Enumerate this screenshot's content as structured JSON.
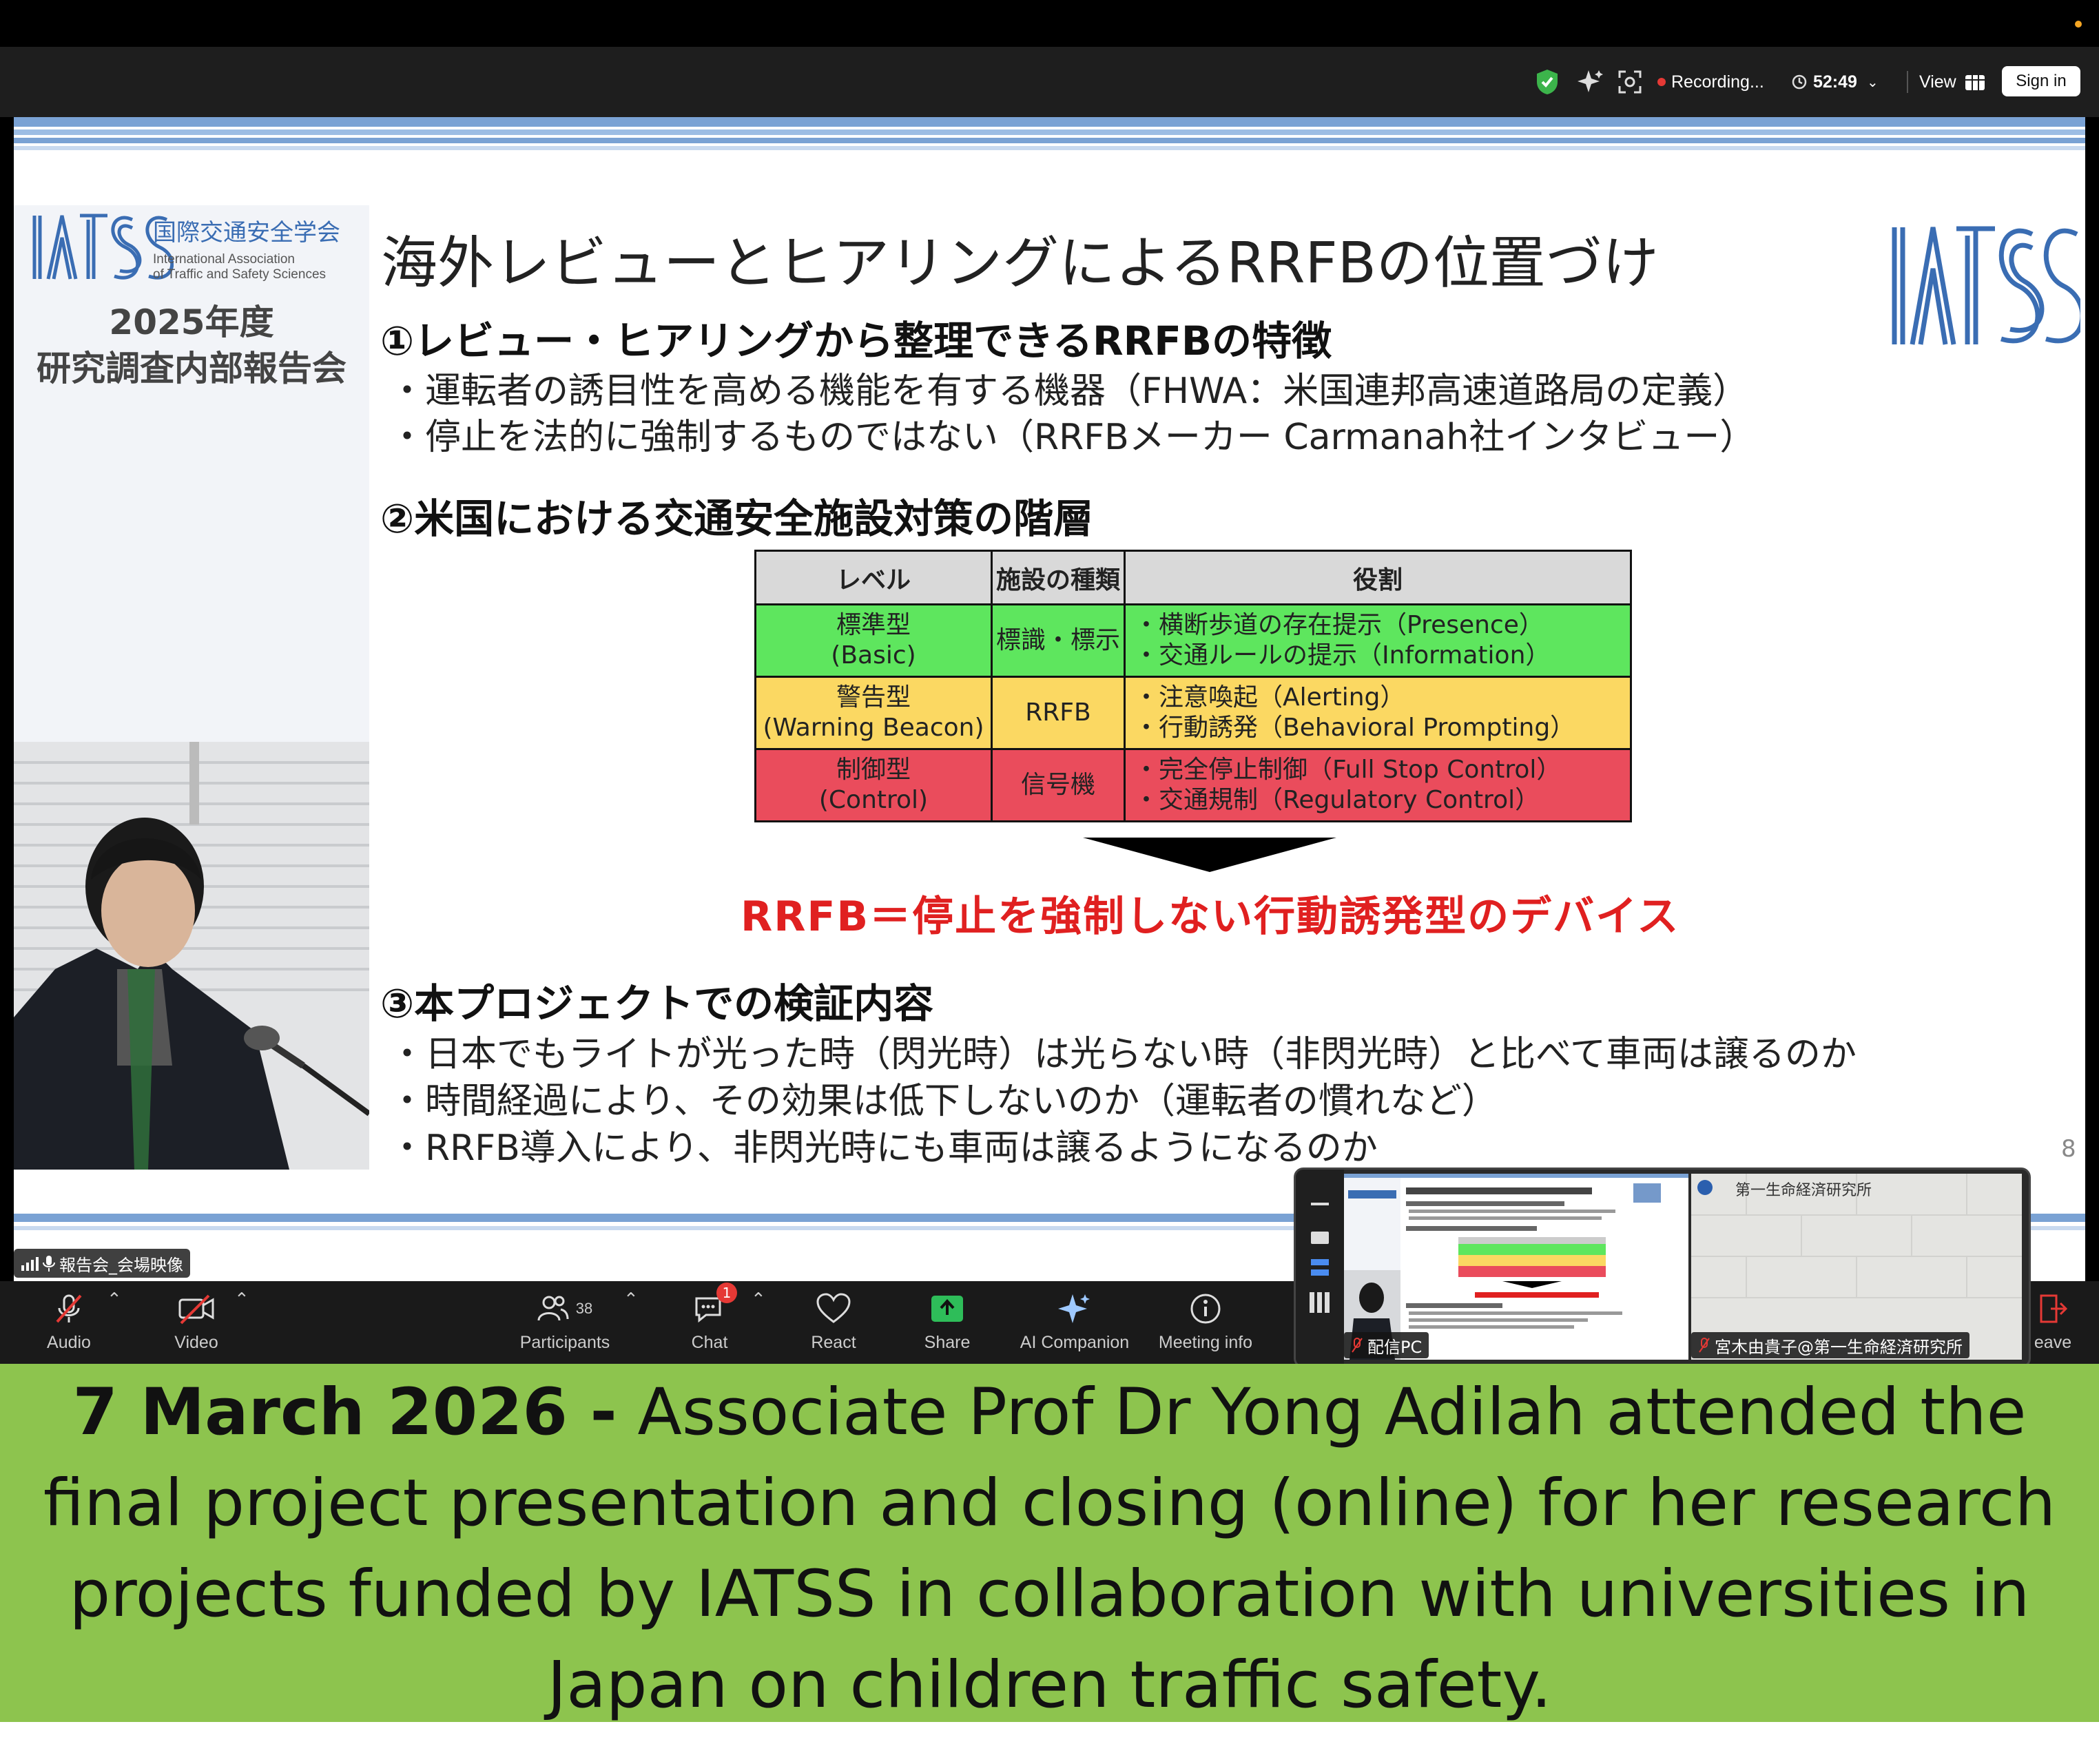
{
  "zoom": {
    "recording_label": "Recording...",
    "timer": "52:49",
    "view_label": "View",
    "signin_label": "Sign in",
    "accent_green": "#3cb44b",
    "recording_color": "#e53935"
  },
  "slide": {
    "org_jp": "国際交通安全学会",
    "org_en_1": "International Association",
    "org_en_2": "of Traffic and Safety Sciences",
    "year_label": "2025年度",
    "report_label": "研究調査内部報告会",
    "title": "海外レビューとヒアリングによるRRFBの位置づけ",
    "section1_heading": "①レビュー・ヒアリングから整理できるRRFBの特徴",
    "section1_bullets": [
      "・運転者の誘目性を高める機能を有する機器（FHWA：米国連邦高速道路局の定義）",
      "・停止を法的に強制するものではない（RRFBメーカー Carmanah社インタビュー）"
    ],
    "section2_heading": "②米国における交通安全施設対策の階層",
    "table": {
      "headers": [
        "レベル",
        "施設の種類",
        "役割"
      ],
      "rows": [
        {
          "level_1": "標準型",
          "level_2": "(Basic)",
          "type": "標識・標示",
          "role_1": "・横断歩道の存在提示（Presence）",
          "role_2": "・交通ルールの提示（Information）",
          "color": "#5ee65e"
        },
        {
          "level_1": "警告型",
          "level_2": "(Warning Beacon)",
          "type": "RRFB",
          "role_1": "・注意喚起（Alerting）",
          "role_2": "・行動誘発（Behavioral Prompting）",
          "color": "#fbd862"
        },
        {
          "level_1": "制御型",
          "level_2": "(Control)",
          "type": "信号機",
          "role_1": "・完全停止制御（Full Stop Control）",
          "role_2": "・交通規制（Regulatory Control）",
          "color": "#ea4c5c"
        }
      ]
    },
    "conclusion": "RRFB＝停止を強制しない行動誘発型のデバイス",
    "section3_heading": "③本プロジェクトでの検証内容",
    "section3_bullets": [
      "・日本でもライトが光った時（閃光時）は光らない時（非閃光時）と比べて車両は譲るのか",
      "・時間経過により、その効果は低下しないのか（運転者の慣れなど）",
      "・RRFB導入により、非閃光時にも車両は譲るようになるのか"
    ],
    "page_number": "8",
    "video_name_tag": "報告会_会場映像"
  },
  "controls": {
    "audio": "Audio",
    "video": "Video",
    "participants": "Participants",
    "participants_count": "38",
    "chat": "Chat",
    "chat_badge": "1",
    "react": "React",
    "share": "Share",
    "ai_companion": "AI Companion",
    "meeting_info": "Meeting info",
    "leave_partial": "eave"
  },
  "pip": {
    "left_label": "配信PC",
    "right_label": "宮木由貴子@第一生命経済研究所",
    "right_org": "第一生命経済研究所"
  },
  "caption": {
    "date": "7 March 2026 -",
    "text": " Associate Prof Dr Yong Adilah attended the final project presentation and closing (online) for her research projects funded by IATSS in collaboration with universities in Japan on children traffic safety.",
    "background": "#8dc44e"
  }
}
